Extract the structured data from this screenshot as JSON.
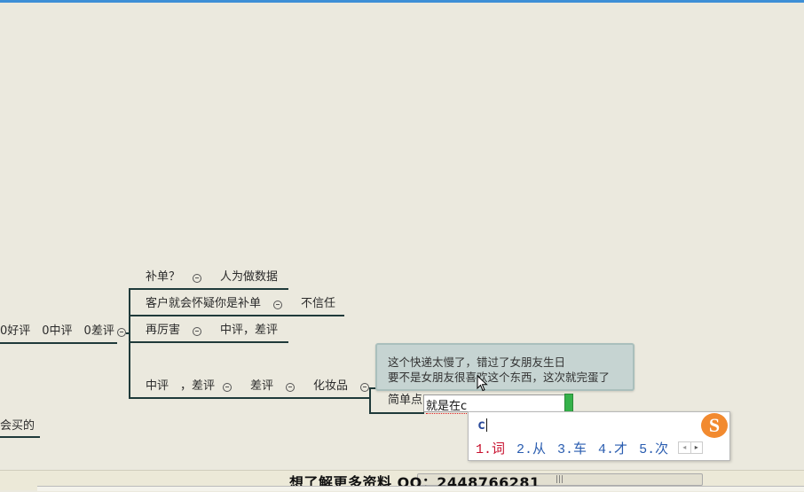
{
  "mindmap": {
    "root_partial": "0好评　0中评　0差评",
    "left_partial": "会买的",
    "branches": {
      "b1": {
        "label": "补单？",
        "child": "人为做数据"
      },
      "b2": {
        "label": "客户就会怀疑你是补单",
        "child": "不信任"
      },
      "b3": {
        "label": "再厉害",
        "child": "中评，差评"
      },
      "b4": {
        "label": "中评　，差评",
        "child1": "差评",
        "child2": "化妆品",
        "child3": "简单点"
      }
    },
    "tooltip": {
      "line1": "这个快递太慢了，错过了女朋友生日",
      "line2": "要不是女朋友很喜欢这个东西，这次就完蛋了"
    },
    "editing": {
      "text": "就是在c"
    }
  },
  "ime": {
    "input": "c",
    "logo": "S",
    "candidates": [
      "1.词",
      "2.从",
      "3.车",
      "4.才",
      "5.次"
    ],
    "prev": "◂",
    "next": "▸"
  },
  "footer": {
    "watermark": "想了解更多资料 QQ：2448766281",
    "grip": "|||"
  },
  "colors": {
    "background": "#ebe9de",
    "line": "#1f3a3a",
    "tooltip_bg": "#c6d4d2",
    "ime_accent": "#f28a2f",
    "topbar": "#3d8fd6"
  }
}
